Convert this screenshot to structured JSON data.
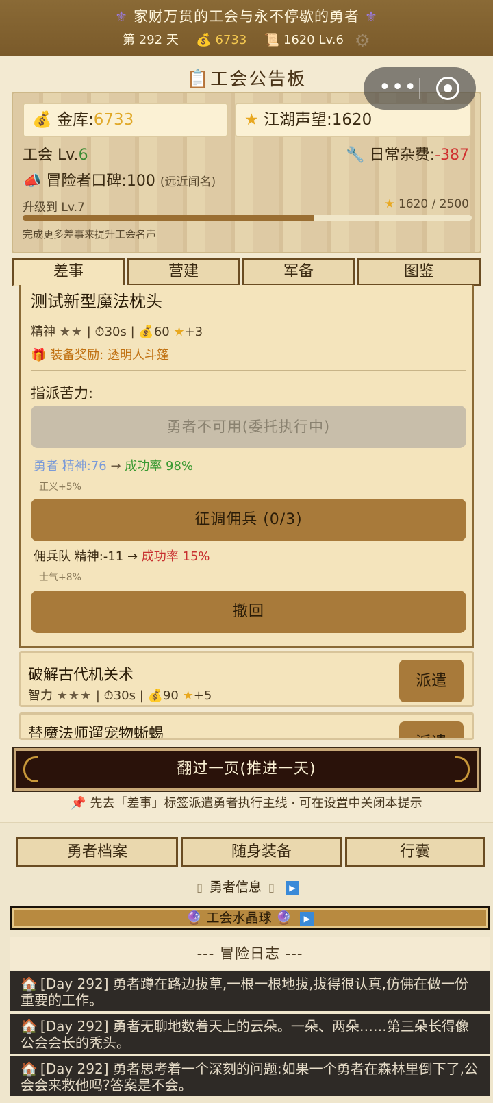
{
  "header": {
    "title": "家财万贯的工会与永不停歇的勇者",
    "day_label": "第 292 天",
    "gold": "6733",
    "scroll_value": "1620 Lv.6"
  },
  "board": {
    "title": "工会公告板"
  },
  "guild": {
    "treasury_label": "金库:",
    "treasury_value": "6733",
    "renown_label": "江湖声望:",
    "renown_value": "1620",
    "level_label": "工会 Lv.",
    "level_value": "6",
    "expense_label": "日常杂费:",
    "expense_value": "-387",
    "reputation_label": "冒险者口碑:",
    "reputation_value": "100",
    "reputation_note": "(远近闻名)",
    "upgrade_label": "升级到 Lv.7",
    "upgrade_progress": "1620 / 2500",
    "upgrade_fraction": 0.648,
    "upgrade_hint": "完成更多差事来提升工会名声"
  },
  "tabs": [
    "差事",
    "营建",
    "军备",
    "图鉴"
  ],
  "quest": {
    "title": "测试新型魔法枕头",
    "attr": "精神",
    "stars": "★★",
    "time": "30s",
    "gold": "60",
    "renown": "+3",
    "reward_label": "装备奖励:",
    "reward_value": "透明人斗篷",
    "assign_label": "指派苦力:",
    "hero_unavailable": "勇者不可用(委托执行中)",
    "hero_name": "勇者",
    "hero_stat": "精神:76",
    "hero_rate_label": "成功率",
    "hero_rate_value": "98%",
    "hero_bonus": "正义+5%",
    "recruit_label": "征调佣兵 (0/3)",
    "merc_name": "佣兵队",
    "merc_stat": "精神:-11",
    "merc_rate_label": "成功率",
    "merc_rate_value": "15%",
    "merc_bonus": "士气+8%",
    "recall_label": "撤回"
  },
  "quest_list": [
    {
      "title": "破解古代机关术",
      "attr": "智力",
      "stars": "★★★",
      "time": "30s",
      "gold": "90",
      "renown": "+5",
      "button": "派遣"
    },
    {
      "title": "替魔法师遛宠物蜥蜴",
      "button": "派遣"
    }
  ],
  "next_day": "翻过一页(推进一天)",
  "hint": "先去「差事」标签派遣勇者执行主线 · 可在设置中关闭本提示",
  "sub_tabs": [
    "勇者档案",
    "随身装备",
    "行囊"
  ],
  "hero_info": "勇者信息",
  "crystal_ball": "工会水晶球",
  "log": {
    "title": "--- 冒险日志 ---",
    "entries": [
      "[Day 292] 勇者蹲在路边拔草,一根一根地拔,拔得很认真,仿佛在做一份重要的工作。",
      "[Day 292] 勇者无聊地数着天上的云朵。一朵、两朵……第三朵长得像公会会长的秃头。",
      "[Day 292] 勇者思考着一个深刻的问题:如果一个勇者在森林里倒下了,公会会来救他吗?答案是不会。"
    ]
  },
  "colors": {
    "header_bg": "#7a5a2a",
    "button_brown": "#a87a3a",
    "success_green": "#3a9a32",
    "fail_red": "#c83030",
    "gold": "#e0a828"
  }
}
